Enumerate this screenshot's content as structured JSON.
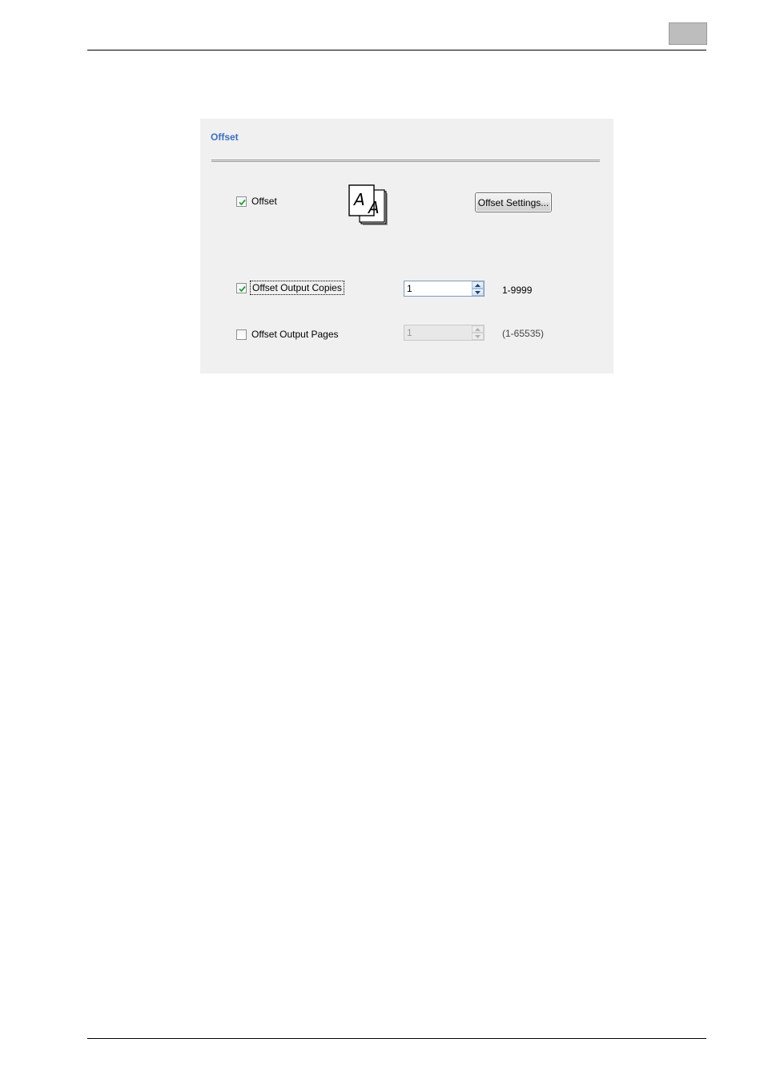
{
  "panel": {
    "title": "Offset"
  },
  "offset": {
    "checkbox_label": "Offset",
    "checked": true,
    "settings_button_label": "Offset Settings..."
  },
  "output_copies": {
    "checkbox_label": "Offset Output Copies",
    "checked": true,
    "value": "1",
    "range": "1-9999"
  },
  "output_pages": {
    "checkbox_label": "Offset Output Pages",
    "checked": false,
    "value": "1",
    "range": "(1-65535)",
    "disabled": true
  },
  "icons": {
    "offset_stack": "offset-stacked-pages-icon",
    "checkmark": "checkmark-icon",
    "spin_up": "spin-up-arrow-icon",
    "spin_down": "spin-down-arrow-icon"
  },
  "colors": {
    "title": "#3c6fc0",
    "panel_bg": "#f0f0f0",
    "check_green": "#1e9e3a"
  }
}
